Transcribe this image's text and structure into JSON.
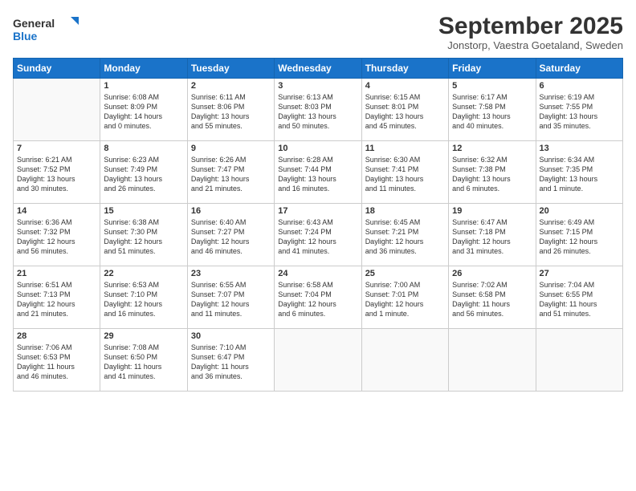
{
  "header": {
    "logo": {
      "text_general": "General",
      "text_blue": "Blue"
    },
    "title": "September 2025",
    "location": "Jonstorp, Vaestra Goetaland, Sweden"
  },
  "weekdays": [
    "Sunday",
    "Monday",
    "Tuesday",
    "Wednesday",
    "Thursday",
    "Friday",
    "Saturday"
  ],
  "weeks": [
    [
      {
        "day": "",
        "info": ""
      },
      {
        "day": "1",
        "info": "Sunrise: 6:08 AM\nSunset: 8:09 PM\nDaylight: 14 hours\nand 0 minutes."
      },
      {
        "day": "2",
        "info": "Sunrise: 6:11 AM\nSunset: 8:06 PM\nDaylight: 13 hours\nand 55 minutes."
      },
      {
        "day": "3",
        "info": "Sunrise: 6:13 AM\nSunset: 8:03 PM\nDaylight: 13 hours\nand 50 minutes."
      },
      {
        "day": "4",
        "info": "Sunrise: 6:15 AM\nSunset: 8:01 PM\nDaylight: 13 hours\nand 45 minutes."
      },
      {
        "day": "5",
        "info": "Sunrise: 6:17 AM\nSunset: 7:58 PM\nDaylight: 13 hours\nand 40 minutes."
      },
      {
        "day": "6",
        "info": "Sunrise: 6:19 AM\nSunset: 7:55 PM\nDaylight: 13 hours\nand 35 minutes."
      }
    ],
    [
      {
        "day": "7",
        "info": "Sunrise: 6:21 AM\nSunset: 7:52 PM\nDaylight: 13 hours\nand 30 minutes."
      },
      {
        "day": "8",
        "info": "Sunrise: 6:23 AM\nSunset: 7:49 PM\nDaylight: 13 hours\nand 26 minutes."
      },
      {
        "day": "9",
        "info": "Sunrise: 6:26 AM\nSunset: 7:47 PM\nDaylight: 13 hours\nand 21 minutes."
      },
      {
        "day": "10",
        "info": "Sunrise: 6:28 AM\nSunset: 7:44 PM\nDaylight: 13 hours\nand 16 minutes."
      },
      {
        "day": "11",
        "info": "Sunrise: 6:30 AM\nSunset: 7:41 PM\nDaylight: 13 hours\nand 11 minutes."
      },
      {
        "day": "12",
        "info": "Sunrise: 6:32 AM\nSunset: 7:38 PM\nDaylight: 13 hours\nand 6 minutes."
      },
      {
        "day": "13",
        "info": "Sunrise: 6:34 AM\nSunset: 7:35 PM\nDaylight: 13 hours\nand 1 minute."
      }
    ],
    [
      {
        "day": "14",
        "info": "Sunrise: 6:36 AM\nSunset: 7:32 PM\nDaylight: 12 hours\nand 56 minutes."
      },
      {
        "day": "15",
        "info": "Sunrise: 6:38 AM\nSunset: 7:30 PM\nDaylight: 12 hours\nand 51 minutes."
      },
      {
        "day": "16",
        "info": "Sunrise: 6:40 AM\nSunset: 7:27 PM\nDaylight: 12 hours\nand 46 minutes."
      },
      {
        "day": "17",
        "info": "Sunrise: 6:43 AM\nSunset: 7:24 PM\nDaylight: 12 hours\nand 41 minutes."
      },
      {
        "day": "18",
        "info": "Sunrise: 6:45 AM\nSunset: 7:21 PM\nDaylight: 12 hours\nand 36 minutes."
      },
      {
        "day": "19",
        "info": "Sunrise: 6:47 AM\nSunset: 7:18 PM\nDaylight: 12 hours\nand 31 minutes."
      },
      {
        "day": "20",
        "info": "Sunrise: 6:49 AM\nSunset: 7:15 PM\nDaylight: 12 hours\nand 26 minutes."
      }
    ],
    [
      {
        "day": "21",
        "info": "Sunrise: 6:51 AM\nSunset: 7:13 PM\nDaylight: 12 hours\nand 21 minutes."
      },
      {
        "day": "22",
        "info": "Sunrise: 6:53 AM\nSunset: 7:10 PM\nDaylight: 12 hours\nand 16 minutes."
      },
      {
        "day": "23",
        "info": "Sunrise: 6:55 AM\nSunset: 7:07 PM\nDaylight: 12 hours\nand 11 minutes."
      },
      {
        "day": "24",
        "info": "Sunrise: 6:58 AM\nSunset: 7:04 PM\nDaylight: 12 hours\nand 6 minutes."
      },
      {
        "day": "25",
        "info": "Sunrise: 7:00 AM\nSunset: 7:01 PM\nDaylight: 12 hours\nand 1 minute."
      },
      {
        "day": "26",
        "info": "Sunrise: 7:02 AM\nSunset: 6:58 PM\nDaylight: 11 hours\nand 56 minutes."
      },
      {
        "day": "27",
        "info": "Sunrise: 7:04 AM\nSunset: 6:55 PM\nDaylight: 11 hours\nand 51 minutes."
      }
    ],
    [
      {
        "day": "28",
        "info": "Sunrise: 7:06 AM\nSunset: 6:53 PM\nDaylight: 11 hours\nand 46 minutes."
      },
      {
        "day": "29",
        "info": "Sunrise: 7:08 AM\nSunset: 6:50 PM\nDaylight: 11 hours\nand 41 minutes."
      },
      {
        "day": "30",
        "info": "Sunrise: 7:10 AM\nSunset: 6:47 PM\nDaylight: 11 hours\nand 36 minutes."
      },
      {
        "day": "",
        "info": ""
      },
      {
        "day": "",
        "info": ""
      },
      {
        "day": "",
        "info": ""
      },
      {
        "day": "",
        "info": ""
      }
    ]
  ]
}
